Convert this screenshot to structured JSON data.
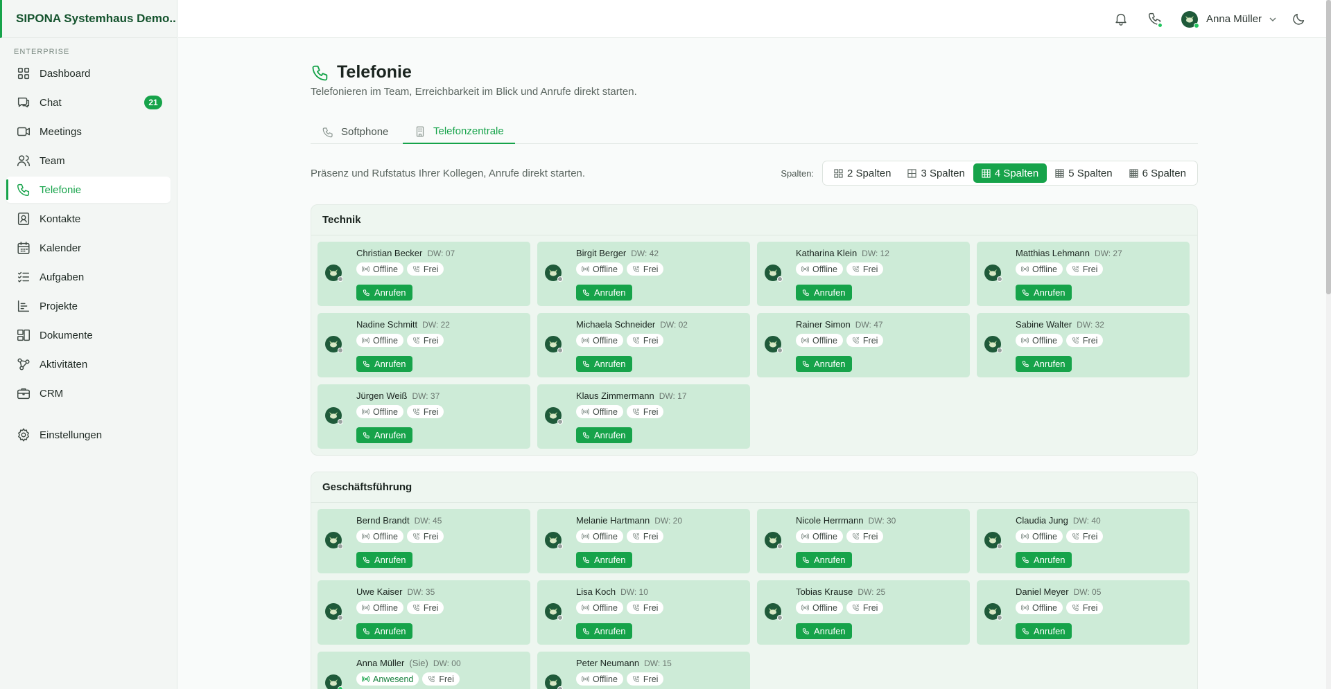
{
  "app": {
    "brand": "SIPONA Systemhaus Demo...",
    "section_label": "ENTERPRISE"
  },
  "sidebar": {
    "items": [
      {
        "label": "Dashboard",
        "icon": "grid-icon"
      },
      {
        "label": "Chat",
        "icon": "chat-icon",
        "badge": "21"
      },
      {
        "label": "Meetings",
        "icon": "video-icon"
      },
      {
        "label": "Team",
        "icon": "users-icon"
      },
      {
        "label": "Telefonie",
        "icon": "phone-icon",
        "active": true
      },
      {
        "label": "Kontakte",
        "icon": "contact-card-icon"
      },
      {
        "label": "Kalender",
        "icon": "calendar-icon"
      },
      {
        "label": "Aufgaben",
        "icon": "task-list-icon"
      },
      {
        "label": "Projekte",
        "icon": "project-chart-icon"
      },
      {
        "label": "Dokumente",
        "icon": "documents-icon"
      },
      {
        "label": "Aktivitäten",
        "icon": "activity-icon"
      },
      {
        "label": "CRM",
        "icon": "briefcase-icon"
      }
    ],
    "settings_label": "Einstellungen"
  },
  "topbar": {
    "user_name": "Anna Müller",
    "icons": [
      "bell-icon",
      "phone-icon",
      "chevron-down-icon",
      "moon-icon"
    ]
  },
  "page": {
    "title": "Telefonie",
    "subtitle": "Telefonieren im Team, Erreichbarkeit im Blick und Anrufe direkt starten.",
    "tabs": [
      {
        "label": "Softphone",
        "icon": "phone-icon"
      },
      {
        "label": "Telefonzentrale",
        "icon": "building-icon",
        "active": true
      }
    ],
    "presence_hint": "Präsenz und Rufstatus Ihrer Kollegen, Anrufe direkt starten.",
    "columns_label": "Spalten:",
    "column_options": [
      "2 Spalten",
      "3 Spalten",
      "4 Spalten",
      "5 Spalten",
      "6 Spalten"
    ],
    "column_active_index": 2
  },
  "labels": {
    "call_button": "Anrufen",
    "call_state_free": "Frei",
    "you_suffix": "(Sie)"
  },
  "colors": {
    "accent": "#16a34a",
    "card_bg": "#cdebd7",
    "status_online": "#22c55e",
    "status_offline": "#9aa3a0"
  },
  "groups": [
    {
      "name": "Technik",
      "members": [
        {
          "name": "Christian Becker",
          "dw": "DW: 07",
          "presence": "Offline"
        },
        {
          "name": "Birgit Berger",
          "dw": "DW: 42",
          "presence": "Offline"
        },
        {
          "name": "Katharina Klein",
          "dw": "DW: 12",
          "presence": "Offline"
        },
        {
          "name": "Matthias Lehmann",
          "dw": "DW: 27",
          "presence": "Offline"
        },
        {
          "name": "Nadine Schmitt",
          "dw": "DW: 22",
          "presence": "Offline"
        },
        {
          "name": "Michaela Schneider",
          "dw": "DW: 02",
          "presence": "Offline"
        },
        {
          "name": "Rainer Simon",
          "dw": "DW: 47",
          "presence": "Offline"
        },
        {
          "name": "Sabine Walter",
          "dw": "DW: 32",
          "presence": "Offline"
        },
        {
          "name": "Jürgen Weiß",
          "dw": "DW: 37",
          "presence": "Offline"
        },
        {
          "name": "Klaus Zimmermann",
          "dw": "DW: 17",
          "presence": "Offline"
        }
      ]
    },
    {
      "name": "Geschäftsführung",
      "members": [
        {
          "name": "Bernd Brandt",
          "dw": "DW: 45",
          "presence": "Offline"
        },
        {
          "name": "Melanie Hartmann",
          "dw": "DW: 20",
          "presence": "Offline"
        },
        {
          "name": "Nicole Herrmann",
          "dw": "DW: 30",
          "presence": "Offline"
        },
        {
          "name": "Claudia Jung",
          "dw": "DW: 40",
          "presence": "Offline"
        },
        {
          "name": "Uwe Kaiser",
          "dw": "DW: 35",
          "presence": "Offline"
        },
        {
          "name": "Lisa Koch",
          "dw": "DW: 10",
          "presence": "Offline"
        },
        {
          "name": "Tobias Krause",
          "dw": "DW: 25",
          "presence": "Offline"
        },
        {
          "name": "Daniel Meyer",
          "dw": "DW: 05",
          "presence": "Offline"
        },
        {
          "name": "Anna Müller",
          "dw": "DW: 00",
          "presence": "Anwesend",
          "is_self": true
        },
        {
          "name": "Peter Neumann",
          "dw": "DW: 15",
          "presence": "Offline"
        }
      ]
    }
  ]
}
